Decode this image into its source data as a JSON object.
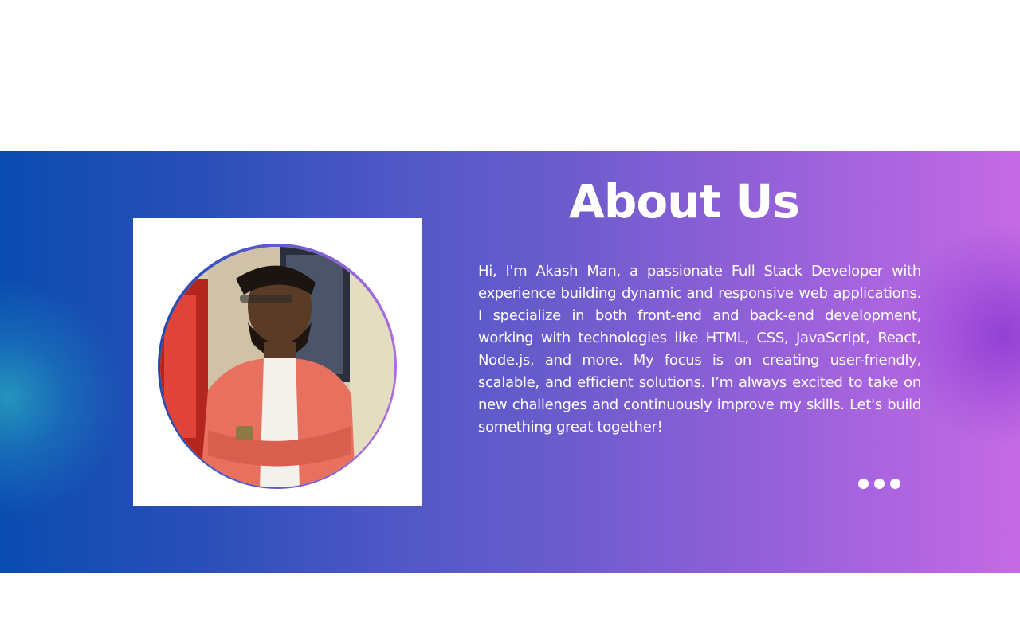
{
  "about": {
    "title": "About Us",
    "description": "Hi, I'm Akash Man, a passionate Full Stack Developer with experience building dynamic and responsive web applications. I specialize in both front-end and back-end development, working with technologies like HTML, CSS, JavaScript, React, Node.js, and more. My focus is on creating user-friendly, scalable, and efficient solutions. I’m always excited to take on new challenges and continuously improve my skills. Let's build something great together!",
    "photo_icon": "profile-photo",
    "carousel_dots": 3
  },
  "colors": {
    "gradient_start": "#0a4cb0",
    "gradient_end": "#c56ae4",
    "text": "#ffffff",
    "card": "#ffffff"
  }
}
